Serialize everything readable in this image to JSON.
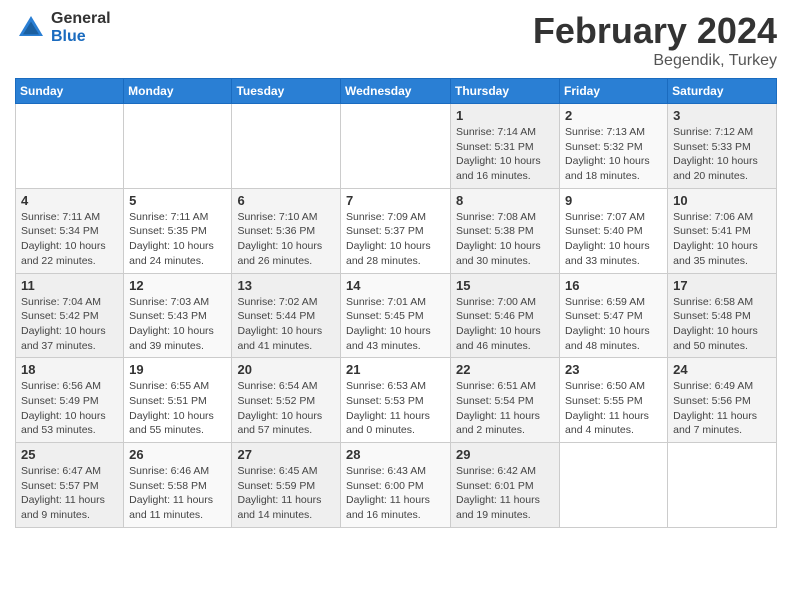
{
  "logo": {
    "general": "General",
    "blue": "Blue"
  },
  "title": "February 2024",
  "subtitle": "Begendik, Turkey",
  "days_header": [
    "Sunday",
    "Monday",
    "Tuesday",
    "Wednesday",
    "Thursday",
    "Friday",
    "Saturday"
  ],
  "weeks": [
    [
      {
        "day": "",
        "info": ""
      },
      {
        "day": "",
        "info": ""
      },
      {
        "day": "",
        "info": ""
      },
      {
        "day": "",
        "info": ""
      },
      {
        "day": "1",
        "info": "Sunrise: 7:14 AM\nSunset: 5:31 PM\nDaylight: 10 hours\nand 16 minutes."
      },
      {
        "day": "2",
        "info": "Sunrise: 7:13 AM\nSunset: 5:32 PM\nDaylight: 10 hours\nand 18 minutes."
      },
      {
        "day": "3",
        "info": "Sunrise: 7:12 AM\nSunset: 5:33 PM\nDaylight: 10 hours\nand 20 minutes."
      }
    ],
    [
      {
        "day": "4",
        "info": "Sunrise: 7:11 AM\nSunset: 5:34 PM\nDaylight: 10 hours\nand 22 minutes."
      },
      {
        "day": "5",
        "info": "Sunrise: 7:11 AM\nSunset: 5:35 PM\nDaylight: 10 hours\nand 24 minutes."
      },
      {
        "day": "6",
        "info": "Sunrise: 7:10 AM\nSunset: 5:36 PM\nDaylight: 10 hours\nand 26 minutes."
      },
      {
        "day": "7",
        "info": "Sunrise: 7:09 AM\nSunset: 5:37 PM\nDaylight: 10 hours\nand 28 minutes."
      },
      {
        "day": "8",
        "info": "Sunrise: 7:08 AM\nSunset: 5:38 PM\nDaylight: 10 hours\nand 30 minutes."
      },
      {
        "day": "9",
        "info": "Sunrise: 7:07 AM\nSunset: 5:40 PM\nDaylight: 10 hours\nand 33 minutes."
      },
      {
        "day": "10",
        "info": "Sunrise: 7:06 AM\nSunset: 5:41 PM\nDaylight: 10 hours\nand 35 minutes."
      }
    ],
    [
      {
        "day": "11",
        "info": "Sunrise: 7:04 AM\nSunset: 5:42 PM\nDaylight: 10 hours\nand 37 minutes."
      },
      {
        "day": "12",
        "info": "Sunrise: 7:03 AM\nSunset: 5:43 PM\nDaylight: 10 hours\nand 39 minutes."
      },
      {
        "day": "13",
        "info": "Sunrise: 7:02 AM\nSunset: 5:44 PM\nDaylight: 10 hours\nand 41 minutes."
      },
      {
        "day": "14",
        "info": "Sunrise: 7:01 AM\nSunset: 5:45 PM\nDaylight: 10 hours\nand 43 minutes."
      },
      {
        "day": "15",
        "info": "Sunrise: 7:00 AM\nSunset: 5:46 PM\nDaylight: 10 hours\nand 46 minutes."
      },
      {
        "day": "16",
        "info": "Sunrise: 6:59 AM\nSunset: 5:47 PM\nDaylight: 10 hours\nand 48 minutes."
      },
      {
        "day": "17",
        "info": "Sunrise: 6:58 AM\nSunset: 5:48 PM\nDaylight: 10 hours\nand 50 minutes."
      }
    ],
    [
      {
        "day": "18",
        "info": "Sunrise: 6:56 AM\nSunset: 5:49 PM\nDaylight: 10 hours\nand 53 minutes."
      },
      {
        "day": "19",
        "info": "Sunrise: 6:55 AM\nSunset: 5:51 PM\nDaylight: 10 hours\nand 55 minutes."
      },
      {
        "day": "20",
        "info": "Sunrise: 6:54 AM\nSunset: 5:52 PM\nDaylight: 10 hours\nand 57 minutes."
      },
      {
        "day": "21",
        "info": "Sunrise: 6:53 AM\nSunset: 5:53 PM\nDaylight: 11 hours\nand 0 minutes."
      },
      {
        "day": "22",
        "info": "Sunrise: 6:51 AM\nSunset: 5:54 PM\nDaylight: 11 hours\nand 2 minutes."
      },
      {
        "day": "23",
        "info": "Sunrise: 6:50 AM\nSunset: 5:55 PM\nDaylight: 11 hours\nand 4 minutes."
      },
      {
        "day": "24",
        "info": "Sunrise: 6:49 AM\nSunset: 5:56 PM\nDaylight: 11 hours\nand 7 minutes."
      }
    ],
    [
      {
        "day": "25",
        "info": "Sunrise: 6:47 AM\nSunset: 5:57 PM\nDaylight: 11 hours\nand 9 minutes."
      },
      {
        "day": "26",
        "info": "Sunrise: 6:46 AM\nSunset: 5:58 PM\nDaylight: 11 hours\nand 11 minutes."
      },
      {
        "day": "27",
        "info": "Sunrise: 6:45 AM\nSunset: 5:59 PM\nDaylight: 11 hours\nand 14 minutes."
      },
      {
        "day": "28",
        "info": "Sunrise: 6:43 AM\nSunset: 6:00 PM\nDaylight: 11 hours\nand 16 minutes."
      },
      {
        "day": "29",
        "info": "Sunrise: 6:42 AM\nSunset: 6:01 PM\nDaylight: 11 hours\nand 19 minutes."
      },
      {
        "day": "",
        "info": ""
      },
      {
        "day": "",
        "info": ""
      }
    ]
  ]
}
